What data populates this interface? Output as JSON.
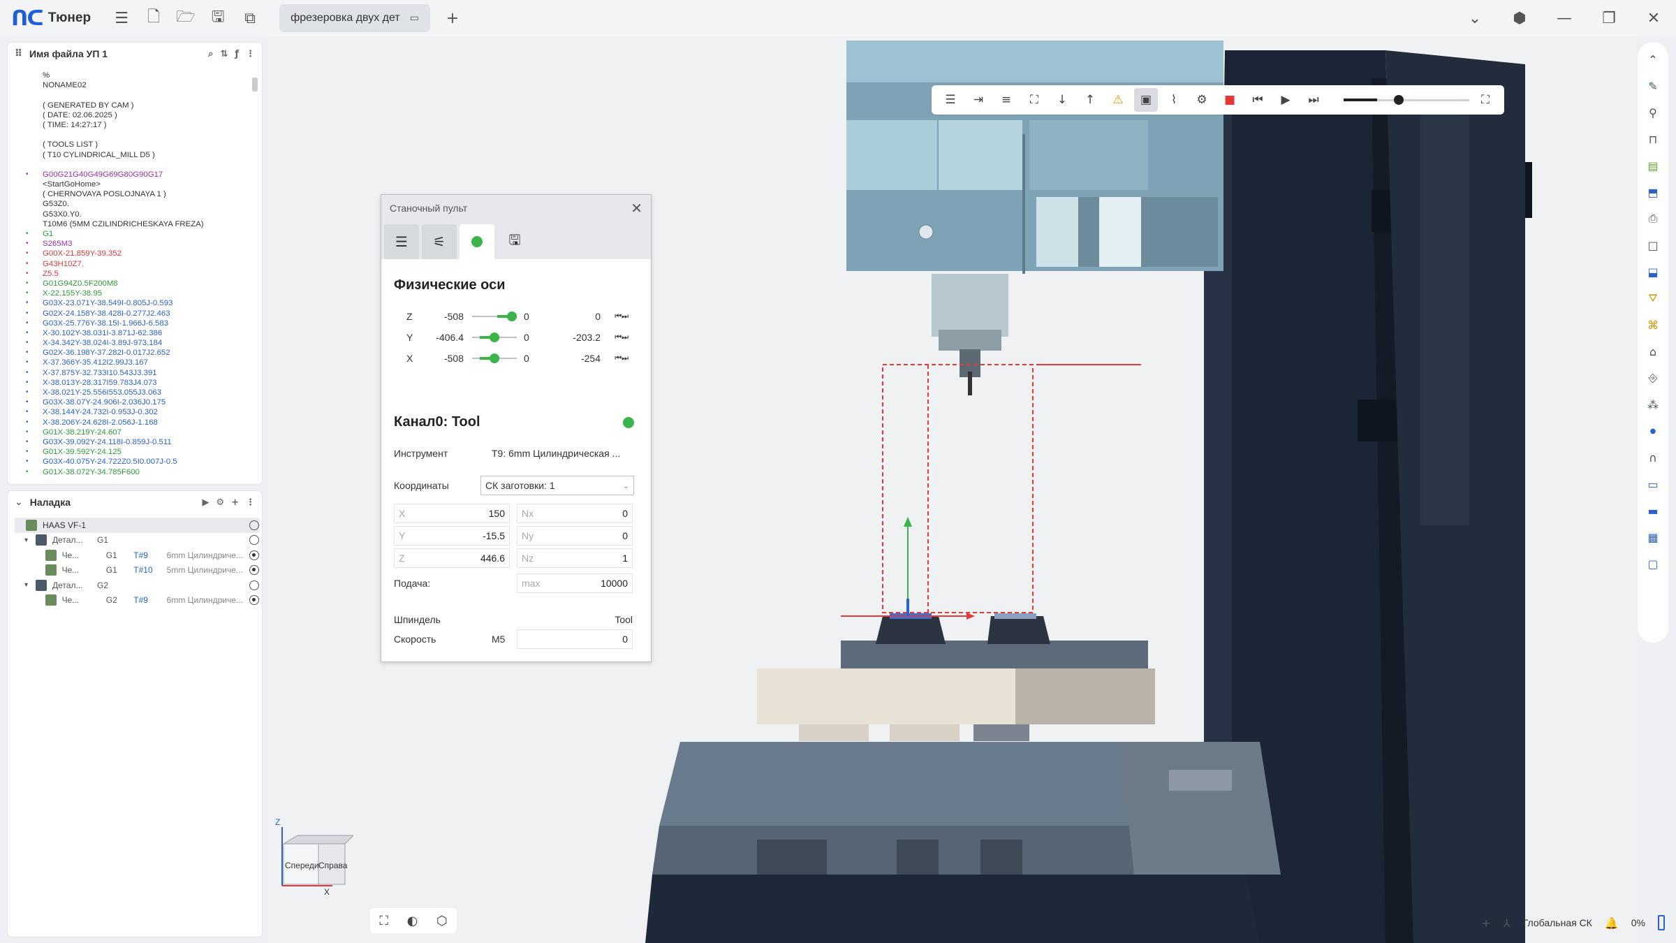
{
  "app": {
    "name": "Тюнер"
  },
  "tabs": [
    {
      "label": "фрезеровка двух дет"
    }
  ],
  "program_panel": {
    "title": "Имя файла УП 1",
    "lines": [
      {
        "text": "%",
        "color": "black"
      },
      {
        "text": "NONAME02",
        "color": "black"
      },
      {
        "text": "",
        "color": "black"
      },
      {
        "text": "( GENERATED BY CAM )",
        "color": "black"
      },
      {
        "text": "( DATE: 02.06.2025 )",
        "color": "black"
      },
      {
        "text": "( TIME: 14:27:17 )",
        "color": "black"
      },
      {
        "text": "",
        "color": "black"
      },
      {
        "text": "( TOOLS LIST )",
        "color": "black"
      },
      {
        "text": "( T10 CYLINDRICAL_MILL D5 )",
        "color": "black"
      },
      {
        "text": "",
        "color": "black"
      },
      {
        "text": "G00G21G40G49G69G80G90G17",
        "color": "purple"
      },
      {
        "text": "<StartGoHome>",
        "color": "black"
      },
      {
        "text": "( CHERNOVAYA POSLOJNAYA 1 )",
        "color": "black"
      },
      {
        "text": "G53Z0.",
        "color": "black"
      },
      {
        "text": "G53X0.Y0.",
        "color": "black"
      },
      {
        "text": "T10M6 (5MM CZILINDRICHESKAYA FREZA)",
        "color": "black"
      },
      {
        "text": "G1",
        "color": "green"
      },
      {
        "text": "S265M3",
        "color": "purple"
      },
      {
        "text": "G00X-21.859Y-39.352",
        "color": "red"
      },
      {
        "text": "G43H10Z7.",
        "color": "red"
      },
      {
        "text": "Z5.5",
        "color": "red"
      },
      {
        "text": "G01G94Z0.5F200M8",
        "color": "green"
      },
      {
        "text": "X-22.155Y-38.95",
        "color": "green"
      },
      {
        "text": "G03X-23.071Y-38.549I-0.805J-0.593",
        "color": "blue"
      },
      {
        "text": "G02X-24.158Y-38.428I-0.277J2.463",
        "color": "blue"
      },
      {
        "text": "G03X-25.776Y-38.15I-1.966J-6.583",
        "color": "blue"
      },
      {
        "text": "X-30.102Y-38.031I-3.871J-62.386",
        "color": "blue"
      },
      {
        "text": "X-34.342Y-38.024I-3.89J-973.184",
        "color": "blue"
      },
      {
        "text": "G02X-36.198Y-37.282I-0.017J2.652",
        "color": "blue"
      },
      {
        "text": "X-37.366Y-35.412I2.99J3.167",
        "color": "blue"
      },
      {
        "text": "X-37.875Y-32.733I10.543J3.391",
        "color": "blue"
      },
      {
        "text": "X-38.013Y-28.317I59.783J4.073",
        "color": "blue"
      },
      {
        "text": "X-38.021Y-25.556I553.055J3.063",
        "color": "blue"
      },
      {
        "text": "G03X-38.07Y-24.906I-2.036J0.175",
        "color": "blue"
      },
      {
        "text": "X-38.144Y-24.732I-0.953J-0.302",
        "color": "blue"
      },
      {
        "text": "X-38.206Y-24.628I-2.056J-1.168",
        "color": "blue"
      },
      {
        "text": "G01X-38.219Y-24.607",
        "color": "green"
      },
      {
        "text": "G03X-39.092Y-24.118I-0.859J-0.511",
        "color": "blue"
      },
      {
        "text": "G01X-39.592Y-24.125",
        "color": "green"
      },
      {
        "text": "G03X-40.075Y-24.722Z0.5I0.007J-0.5",
        "color": "blue"
      },
      {
        "text": "G01X-38.072Y-34.785F600",
        "color": "green"
      }
    ]
  },
  "setup_panel": {
    "title": "Наладка",
    "rows": [
      {
        "indent": 0,
        "caret": "",
        "c1": "HAAS VF-1",
        "c2": "",
        "c3": "",
        "c4": "",
        "radio": false,
        "selected": true
      },
      {
        "indent": 1,
        "caret": "▾",
        "c1": "Детал...",
        "c2": "G1",
        "c3": "",
        "c4": "",
        "radio": false
      },
      {
        "indent": 2,
        "caret": "",
        "c1": "Че...",
        "c2": "G1",
        "c3": "T#9",
        "c4": "6mm Цилиндриче...",
        "radio": true
      },
      {
        "indent": 2,
        "caret": "",
        "c1": "Че...",
        "c2": "G1",
        "c3": "T#10",
        "c4": "5mm Цилиндриче...",
        "radio": true
      },
      {
        "indent": 1,
        "caret": "▾",
        "c1": "Детал...",
        "c2": "G2",
        "c3": "",
        "c4": "",
        "radio": false
      },
      {
        "indent": 2,
        "caret": "",
        "c1": "Че...",
        "c2": "G2",
        "c3": "T#9",
        "c4": "6mm Цилиндриче...",
        "radio": true
      }
    ]
  },
  "console": {
    "title": "Станочный пульт",
    "axes_title": "Физические оси",
    "axes": [
      {
        "name": "Z",
        "min": "-508",
        "current": "0",
        "value": "0",
        "level": 1.0
      },
      {
        "name": "Y",
        "min": "-406.4",
        "current": "0",
        "value": "-203.2",
        "level": 0.5
      },
      {
        "name": "X",
        "min": "-508",
        "current": "0",
        "value": "-254",
        "level": 0.5
      }
    ],
    "channel_title": "Канал0: Tool",
    "tool_label": "Инструмент",
    "tool_value": "T9: 6mm Цилиндрическая ...",
    "coords_label": "Координаты",
    "coords_value": "СК заготовки: 1",
    "pos": [
      {
        "axis": "X",
        "value": "150",
        "n": "Nx",
        "nvalue": "0"
      },
      {
        "axis": "Y",
        "value": "-15.5",
        "n": "Ny",
        "nvalue": "0"
      },
      {
        "axis": "Z",
        "value": "446.6",
        "n": "Nz",
        "nvalue": "1"
      }
    ],
    "feed_label": "Подача:",
    "feed_placeholder": "max",
    "feed_value": "10000",
    "spindle_label": "Шпиндель",
    "spindle_value": "Tool",
    "speed_label": "Скорость",
    "speed_code": "M5",
    "speed_value": "0"
  },
  "view_cube": {
    "front": "Спереди",
    "right": "Справа",
    "z": "Z",
    "x": "X"
  },
  "statusbar": {
    "cs": "Глобальная СК",
    "zoom": "0%"
  },
  "colors": {
    "accent": "#1d5fd6",
    "status_ok": "#3bb54a",
    "stop": "#e53939"
  }
}
